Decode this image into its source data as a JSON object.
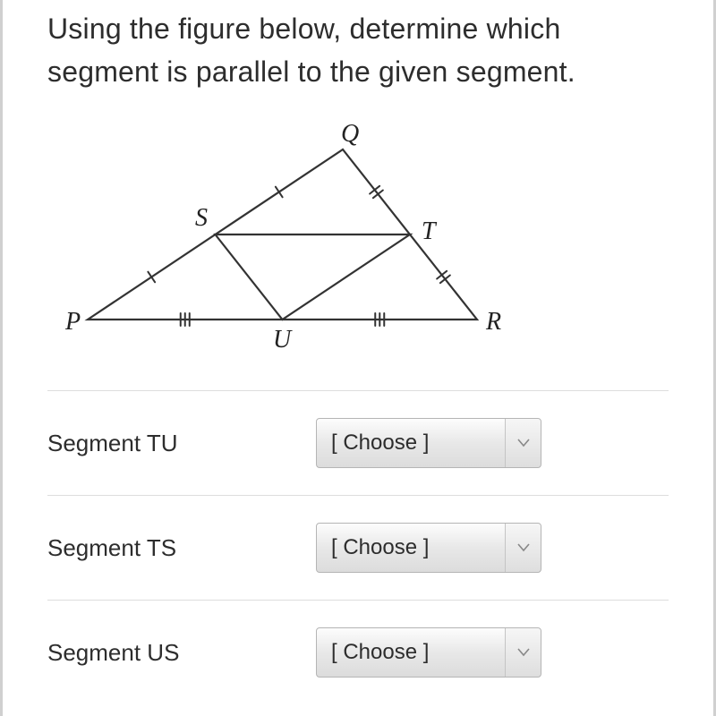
{
  "question": "Using the figure below, determine which segment is parallel to the given segment.",
  "figure": {
    "labels": {
      "P": "P",
      "Q": "Q",
      "R": "R",
      "S": "S",
      "T": "T",
      "U": "U"
    }
  },
  "items": [
    {
      "label": "Segment TU",
      "placeholder": "[ Choose ]"
    },
    {
      "label": "Segment TS",
      "placeholder": "[ Choose ]"
    },
    {
      "label": "Segment US",
      "placeholder": "[ Choose ]"
    }
  ]
}
